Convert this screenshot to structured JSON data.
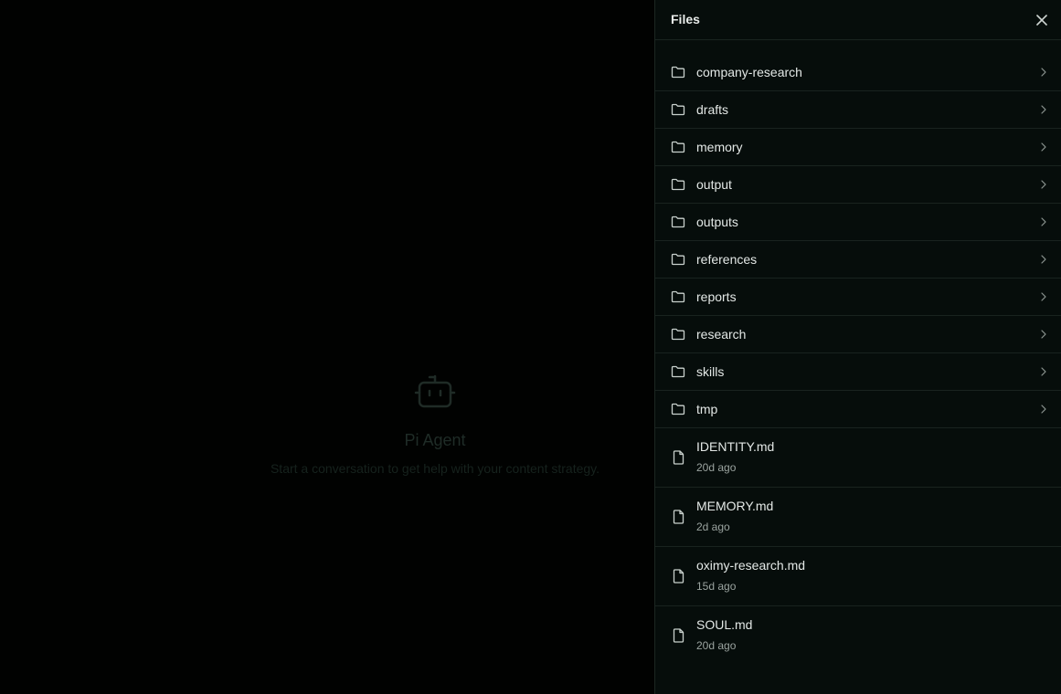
{
  "empty_state": {
    "icon": "robot-icon",
    "title": "Pi Agent",
    "subtitle": "Start a conversation to get help with your content strategy."
  },
  "files_panel": {
    "title": "Files",
    "close_icon": "close-icon",
    "folders": [
      {
        "name": "company-research"
      },
      {
        "name": "drafts"
      },
      {
        "name": "memory"
      },
      {
        "name": "output"
      },
      {
        "name": "outputs"
      },
      {
        "name": "references"
      },
      {
        "name": "reports"
      },
      {
        "name": "research"
      },
      {
        "name": "skills"
      },
      {
        "name": "tmp"
      }
    ],
    "files": [
      {
        "name": "IDENTITY.md",
        "modified": "20d ago"
      },
      {
        "name": "MEMORY.md",
        "modified": "2d ago"
      },
      {
        "name": "oximy-research.md",
        "modified": "15d ago"
      },
      {
        "name": "SOUL.md",
        "modified": "20d ago"
      }
    ]
  },
  "colors": {
    "background": "#000000",
    "panel_background": "#060d0b",
    "text_primary": "#e3e8e6",
    "text_secondary": "#9aa39f",
    "divider": "#19231f"
  }
}
